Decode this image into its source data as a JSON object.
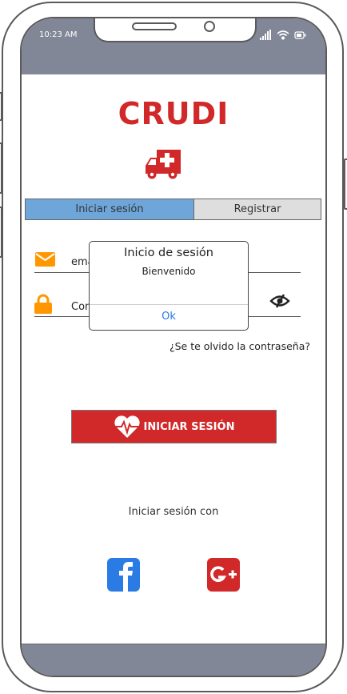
{
  "status_bar": {
    "time": "10:23 AM",
    "icons": [
      "signal-icon",
      "wifi-icon",
      "battery-icon"
    ]
  },
  "app": {
    "title": "CRUDI",
    "logo_icon": "ambulance-icon",
    "brand_color": "#d1292a"
  },
  "tabs": [
    {
      "label": "Iniciar sesión",
      "active": true
    },
    {
      "label": "Registrar",
      "active": false
    }
  ],
  "form": {
    "email_placeholder": "email",
    "password_placeholder": "Contraseña",
    "forgot_label": "¿Se te olvido la contraseña?",
    "submit_label": "INICIAR SESIÓN"
  },
  "social": {
    "label": "Iniciar sesión con",
    "providers": [
      "facebook-icon",
      "google-plus-icon"
    ]
  },
  "dialog": {
    "title": "Inicio de sesión",
    "message": "Bienvenido",
    "ok_label": "Ok"
  }
}
